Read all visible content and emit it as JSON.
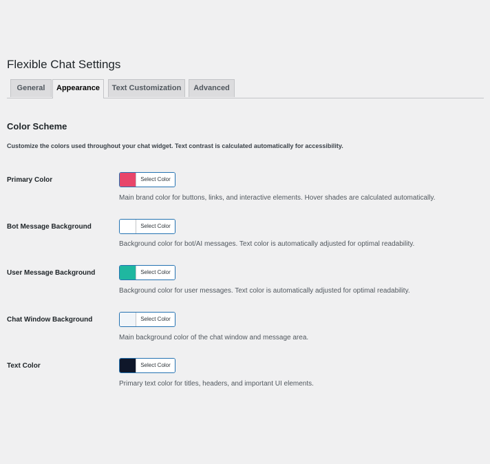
{
  "page": {
    "title": "Flexible Chat Settings"
  },
  "tabs": [
    {
      "label": "General",
      "active": false
    },
    {
      "label": "Appearance",
      "active": true
    },
    {
      "label": "Text Customization",
      "active": false
    },
    {
      "label": "Advanced",
      "active": false
    }
  ],
  "section": {
    "title": "Color Scheme",
    "description": "Customize the colors used throughout your chat widget. Text contrast is calculated automatically for accessibility."
  },
  "colors": [
    {
      "label": "Primary Color",
      "button": "Select Color",
      "swatch": "#e8466a",
      "description": "Main brand color for buttons, links, and interactive elements. Hover shades are calculated automatically."
    },
    {
      "label": "Bot Message Background",
      "button": "Select Color",
      "swatch": "#ffffff",
      "description": "Background color for bot/AI messages. Text color is automatically adjusted for optimal readability."
    },
    {
      "label": "User Message Background",
      "button": "Select Color",
      "swatch": "#1fb7a0",
      "description": "Background color for user messages. Text color is automatically adjusted for optimal readability."
    },
    {
      "label": "Chat Window Background",
      "button": "Select Color",
      "swatch": "#f1f5f9",
      "description": "Main background color of the chat window and message area."
    },
    {
      "label": "Text Color",
      "button": "Select Color",
      "swatch": "#0f172a",
      "description": "Primary text color for titles, headers, and important UI elements."
    }
  ]
}
